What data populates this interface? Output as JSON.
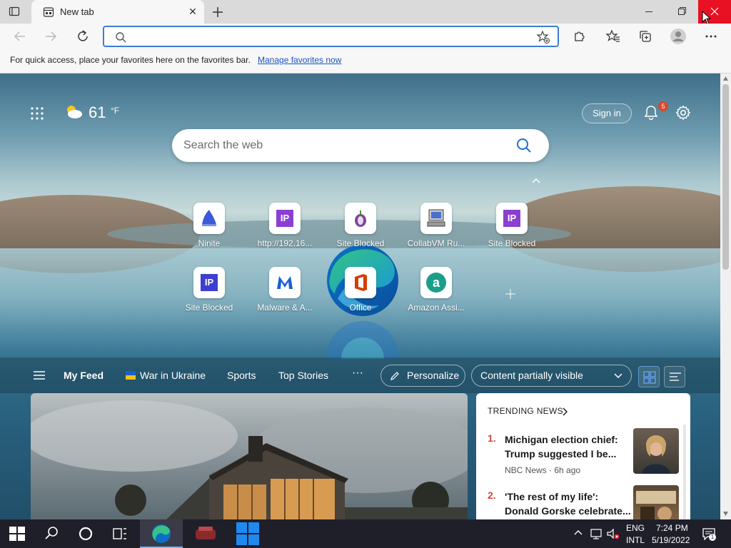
{
  "browser": {
    "tab_title": "New tab",
    "omnibox_value": "",
    "favbar_text": "For quick access, place your favorites here on the favorites bar.",
    "favbar_link": "Manage favorites now"
  },
  "header": {
    "temperature": "61",
    "unit": "°F",
    "signin_label": "Sign in",
    "notification_count": "5",
    "search_placeholder": "Search the web"
  },
  "tiles": [
    {
      "label": "Ninite",
      "icon": "ninite-icon"
    },
    {
      "label": "http://192.16...",
      "icon": "ip-icon"
    },
    {
      "label": "Site Blocked",
      "icon": "tor-icon"
    },
    {
      "label": "CollabVM Ru...",
      "icon": "computer-icon"
    },
    {
      "label": "Site Blocked",
      "icon": "ip-icon"
    },
    {
      "label": "Site Blocked",
      "icon": "ip-icon"
    },
    {
      "label": "Malware & A...",
      "icon": "malwarebytes-icon"
    },
    {
      "label": "Office",
      "icon": "office-icon"
    },
    {
      "label": "Amazon Assi...",
      "icon": "amazon-icon"
    }
  ],
  "feed_nav": {
    "my_feed": "My Feed",
    "war": "War in Ukraine",
    "sports": "Sports",
    "top_stories": "Top Stories",
    "more": "···",
    "personalize": "Personalize",
    "content_visibility": "Content partially visible"
  },
  "trending": {
    "heading": "TRENDING NEWS",
    "items": [
      {
        "num": "1.",
        "title": "Michigan election chief: Trump suggested I be...",
        "source": "NBC News · 6h ago"
      },
      {
        "num": "2.",
        "title": "'The rest of my life': Donald Gorske celebrate...",
        "source": ""
      }
    ]
  },
  "taskbar": {
    "lang1": "ENG",
    "lang2": "INTL",
    "time": "7:24 PM",
    "date": "5/19/2022"
  },
  "colors": {
    "accent": "#0078d4",
    "close_red": "#e81123",
    "trend_number": "#c94a3a"
  }
}
